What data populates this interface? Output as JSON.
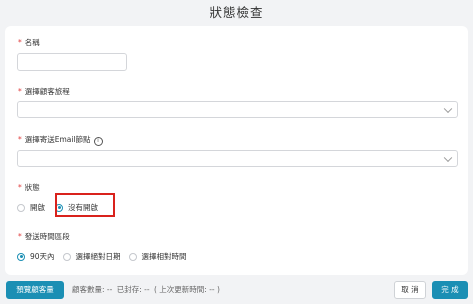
{
  "title": "狀態檢查",
  "form": {
    "name_label": "名稱",
    "name_value": "",
    "journey_label": "選擇顧客旅程",
    "journey_value": "",
    "email_node_label": "選擇寄送Email節點",
    "email_node_value": "",
    "status_label": "狀態",
    "status_options": [
      "開啟",
      "沒有開啟"
    ],
    "status_selected": "沒有開啟",
    "period_label": "發送時間區段",
    "period_options": [
      "90天內",
      "選擇絕對日期",
      "選擇相對時間"
    ],
    "period_selected": "90天內",
    "info_icon": "info-circle-icon",
    "dropdown_icon": "chevron-down-icon"
  },
  "footer": {
    "preview_button": "預覽顧客量",
    "customer_count_label": "顧客數量:",
    "customer_count_value": "--",
    "sealed_label": "已封存:",
    "sealed_value": "--",
    "last_update": "( 上次更新時間: -- )",
    "cancel_button": "取 消",
    "done_button": "完 成"
  },
  "colors": {
    "accent": "#1b8fb4",
    "required": "#e03c3c",
    "highlight_box": "#d9221c",
    "background": "#f2f3f5"
  }
}
